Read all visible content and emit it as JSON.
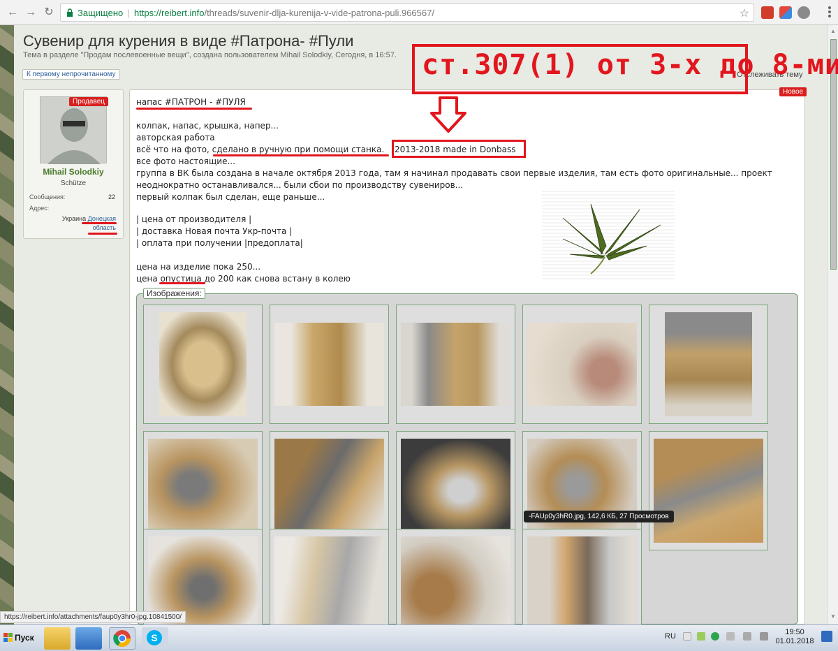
{
  "browser": {
    "secure_label": "Защищено",
    "url_host": "https://reibert.info",
    "url_path": "/threads/suvenir-dlja-kurenija-v-vide-patrona-puli.966567/"
  },
  "thread": {
    "title": "Сувенир для курения в виде #Патрона- #Пули",
    "description": "Тема в разделе \"Продам послевоенные вещи\", создана пользователем Mihail Solodkiy, Сегодня, в 16:57.",
    "unread_button": "К первому непрочитанному",
    "follow": "Отслеживать тему"
  },
  "annotation": {
    "text": "ст.307(1) от 3-х до 8-ми"
  },
  "user": {
    "badge": "Продавец",
    "name": "Mihail Solodkiy",
    "rank": "Schütze",
    "messages_label": "Сообщения:",
    "messages_value": "22",
    "address_label": "Адрес:",
    "address_country": "Украина",
    "address_region_1": "Донецкая",
    "address_region_2": "область"
  },
  "post": {
    "new_badge": "Новое",
    "line1": "напас #ПАТРОН - #ПУЛЯ",
    "line2": "колпак, напас, крышка, напер...",
    "line3": "авторская работа",
    "line4a": "всё что на фото, сделано в ручную при помощи станка.",
    "line4b": "2013-2018 made in Donbass",
    "line5": "все фото настоящие...",
    "line6": "группа в ВК была создана в начале октября 2013 года, там я начинал продавать свои первые изделия, там есть фото оригинальные... проект",
    "line7": "неоднократно останавливался... были сбои по производству сувениров...",
    "line8": "первый колпак был сделан, еще раньше...",
    "line9": "| цена от производителя |",
    "line10": "| доставка Новая почта Укр-почта |",
    "line11": "| оплата при получении |предоплата|",
    "line12": "цена на изделие пока 250...",
    "line13": "цена опустица до 200 как снова встану в колею"
  },
  "gallery": {
    "label": "Изображения:",
    "tooltip": "-FAUp0y3hR0.jpg, 142,6 КБ, 27 Просмотров"
  },
  "status_url": "https://reibert.info/attachments/faup0y3hr0-jpg.10841500/",
  "taskbar": {
    "start": "Пуск",
    "lang": "RU",
    "time": "19:50",
    "date": "01.01.2018"
  },
  "colors": {
    "annotation_red": "#e2161d",
    "secure_green": "#0b8043",
    "username_green": "#4a7a2a",
    "badge_red": "#d9201f"
  }
}
